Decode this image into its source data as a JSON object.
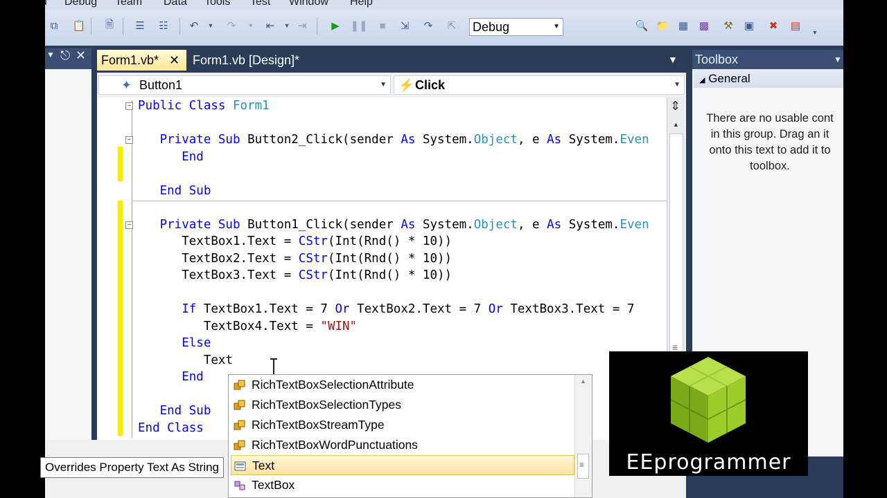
{
  "menu": [
    "d",
    "Debug",
    "Team",
    "Data",
    "Tools",
    "Test",
    "Window",
    "Help"
  ],
  "toolbar": {
    "configuration": "Debug"
  },
  "tabs": [
    {
      "label": "Form1.vb*",
      "active": true
    },
    {
      "label": "Form1.vb [Design]*",
      "active": false
    }
  ],
  "navbar": {
    "object": "Button1",
    "event": "Click"
  },
  "code": {
    "l1_kw": "Public Class",
    "l1_name": "Form1",
    "l2_kw1": "Private Sub",
    "l2_rest1": "Button2_Click(sender",
    "l2_as1": "As",
    "l2_sys1": "System.",
    "l2_obj": "Object",
    "l2_comma": ", e",
    "l2_as2": "As",
    "l2_sys2": "System.",
    "l2_even": "Even",
    "l3_kw": "End",
    "l4_kw": "End Sub",
    "l5_kw1": "Private Sub",
    "l5_rest1": "Button1_Click(sender",
    "l5_as1": "As",
    "l5_sys1": "System.",
    "l5_obj": "Object",
    "l5_comma": ", e",
    "l5_as2": "As",
    "l5_sys2": "System.",
    "l5_even": "Even",
    "l6_a": "TextBox1.Text = ",
    "l6_fn": "CStr",
    "l6_b": "(Int(Rnd() * 10))",
    "l7_a": "TextBox2.Text = ",
    "l7_fn": "CStr",
    "l7_b": "(Int(Rnd() * 10))",
    "l8_a": "TextBox3.Text = ",
    "l8_fn": "CStr",
    "l8_b": "(Int(Rnd() * 10))",
    "l9_if": "If",
    "l9_a": " TextBox1.Text = 7 ",
    "l9_or1": "Or",
    "l9_b": " TextBox2.Text = 7 ",
    "l9_or2": "Or",
    "l9_c": " TextBox3.Text = 7",
    "l10_a": "TextBox4.Text = ",
    "l10_str": "\"WIN\"",
    "l11_kw": "Else",
    "l12": "Text",
    "l13_kw": "End",
    "l14_kw": "End Sub",
    "l15_kw": "End Class"
  },
  "toolbox": {
    "title": "Toolbox",
    "group": "General",
    "empty_l1": "There are no usable cont",
    "empty_l2": "in this group. Drag an it",
    "empty_l3": "onto this text to add it to",
    "empty_l4": "toolbox."
  },
  "tooltip": "Overrides Property Text As String",
  "completion": [
    {
      "label": "RichTextBoxSelectionAttribute",
      "icon": "enum-icon"
    },
    {
      "label": "RichTextBoxSelectionTypes",
      "icon": "enum-icon"
    },
    {
      "label": "RichTextBoxStreamType",
      "icon": "enum-icon"
    },
    {
      "label": "RichTextBoxWordPunctuations",
      "icon": "enum-icon"
    },
    {
      "label": "Text",
      "icon": "property-icon",
      "selected": true
    },
    {
      "label": "TextBox",
      "icon": "class-icon"
    }
  ],
  "logo": {
    "text": "EEprogrammer"
  },
  "colors": {
    "keyword": "#0000ff",
    "type": "#2b91af",
    "string": "#a31515",
    "frame": "#2b3c59",
    "selection": "#ffe89a"
  }
}
